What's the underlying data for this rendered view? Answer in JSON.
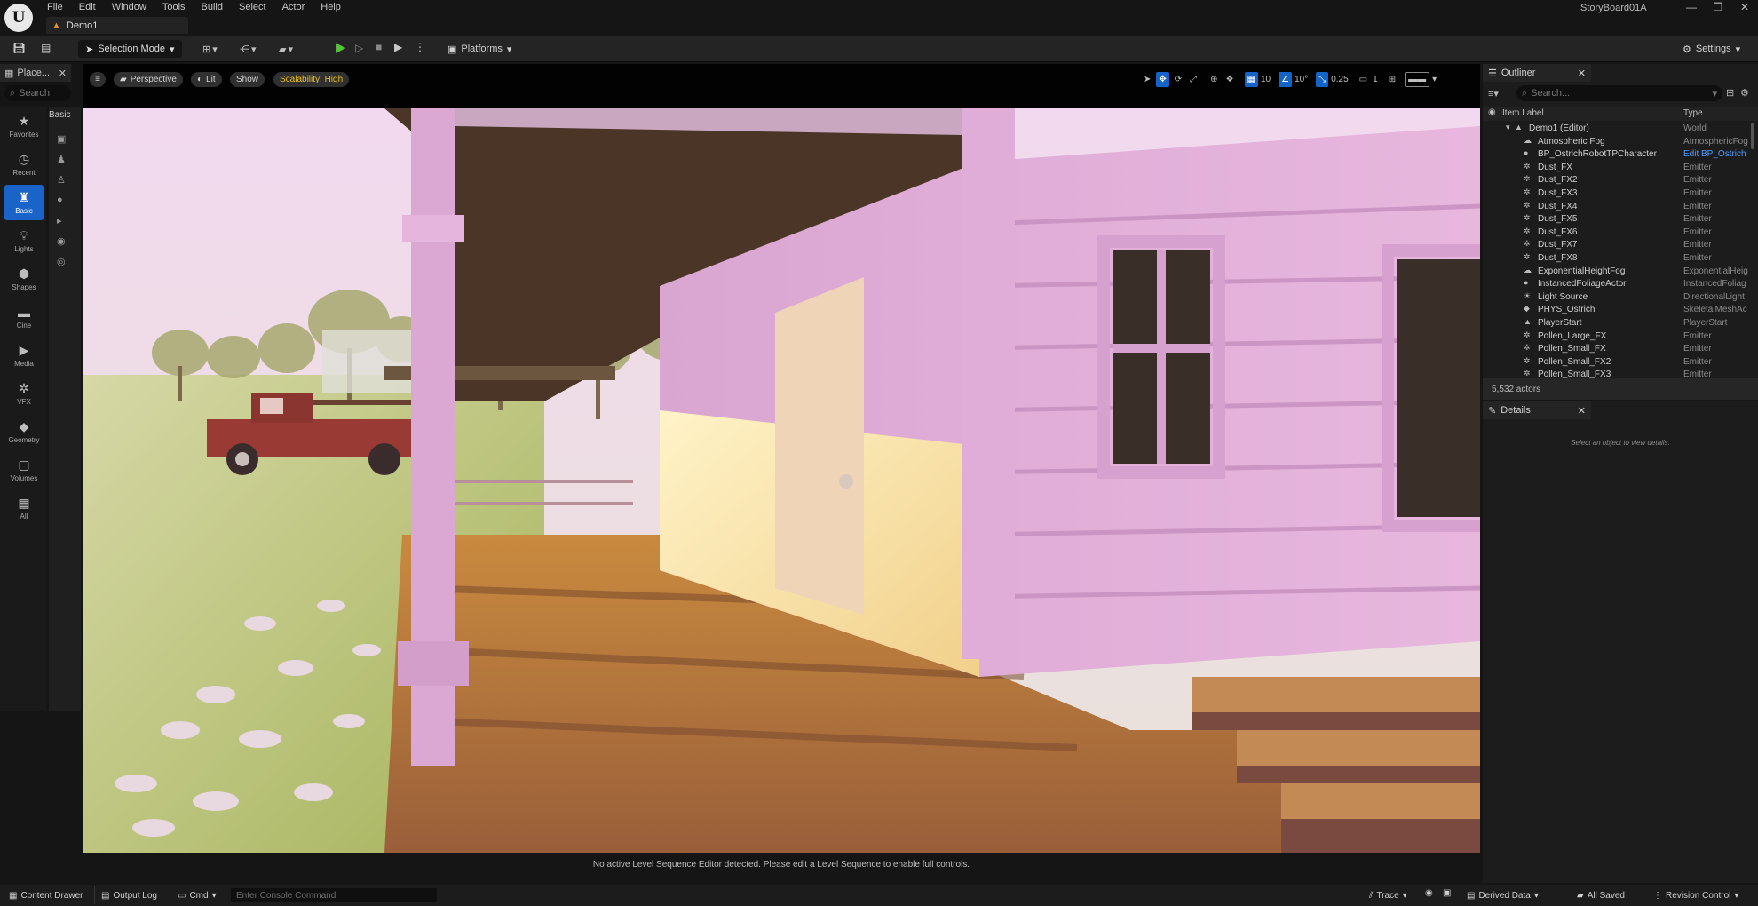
{
  "app": {
    "logo": "U",
    "project_name": "StoryBoard01A",
    "level_tab": "Demo1"
  },
  "menu": [
    "File",
    "Edit",
    "Window",
    "Tools",
    "Build",
    "Select",
    "Actor",
    "Help"
  ],
  "window_controls": [
    "—",
    "❐",
    "✕"
  ],
  "toolbar": {
    "selection_mode": "Selection Mode",
    "platforms": "Platforms",
    "settings": "Settings"
  },
  "place_panel": {
    "title": "Place...",
    "search_placeholder": "Search",
    "categories": [
      "Favorites",
      "Recent",
      "Basic",
      "Lights",
      "Shapes",
      "Cine",
      "Media",
      "VFX",
      "Geometry",
      "Volumes",
      "All"
    ],
    "active_category": "Basic",
    "basic_header": "Basic"
  },
  "viewport": {
    "perspective": "Perspective",
    "lit": "Lit",
    "show": "Show",
    "scalability": "Scalability: High",
    "grid_snap": "10",
    "rot_snap": "10°",
    "scale_snap": "0.25",
    "camera_speed": "1",
    "sequencer_message": "No active Level Sequence Editor detected. Please edit a Level Sequence to enable full controls."
  },
  "outliner": {
    "title": "Outliner",
    "search_placeholder": "Search...",
    "col_label": "Item Label",
    "col_type": "Type",
    "root": {
      "label": "Demo1 (Editor)",
      "type": "World"
    },
    "rows": [
      {
        "label": "Atmospheric Fog",
        "type": "AtmosphericFog",
        "icon": "☁"
      },
      {
        "label": "BP_OstrichRobotTPCharacter",
        "type": "Edit BP_Ostrich",
        "icon": "●",
        "link": true
      },
      {
        "label": "Dust_FX",
        "type": "Emitter",
        "icon": "✲"
      },
      {
        "label": "Dust_FX2",
        "type": "Emitter",
        "icon": "✲"
      },
      {
        "label": "Dust_FX3",
        "type": "Emitter",
        "icon": "✲"
      },
      {
        "label": "Dust_FX4",
        "type": "Emitter",
        "icon": "✲"
      },
      {
        "label": "Dust_FX5",
        "type": "Emitter",
        "icon": "✲"
      },
      {
        "label": "Dust_FX6",
        "type": "Emitter",
        "icon": "✲"
      },
      {
        "label": "Dust_FX7",
        "type": "Emitter",
        "icon": "✲"
      },
      {
        "label": "Dust_FX8",
        "type": "Emitter",
        "icon": "✲"
      },
      {
        "label": "ExponentialHeightFog",
        "type": "ExponentialHeig",
        "icon": "☁"
      },
      {
        "label": "InstancedFoliageActor",
        "type": "InstancedFoliag",
        "icon": "●"
      },
      {
        "label": "Light Source",
        "type": "DirectionalLight",
        "icon": "☀"
      },
      {
        "label": "PHYS_Ostrich",
        "type": "SkeletalMeshAc",
        "icon": "◆"
      },
      {
        "label": "PlayerStart",
        "type": "PlayerStart",
        "icon": "▲"
      },
      {
        "label": "Pollen_Large_FX",
        "type": "Emitter",
        "icon": "✲"
      },
      {
        "label": "Pollen_Small_FX",
        "type": "Emitter",
        "icon": "✲"
      },
      {
        "label": "Pollen_Small_FX2",
        "type": "Emitter",
        "icon": "✲"
      },
      {
        "label": "Pollen_Small_FX3",
        "type": "Emitter",
        "icon": "✲"
      }
    ],
    "footer": "5,532 actors"
  },
  "details": {
    "title": "Details",
    "empty_message": "Select an object to view details."
  },
  "bottom": {
    "content_drawer": "Content Drawer",
    "output_log": "Output Log",
    "cmd": "Cmd",
    "console_placeholder": "Enter Console Command",
    "trace": "Trace",
    "derived_data": "Derived Data",
    "all_saved": "All Saved",
    "revision_control": "Revision Control"
  },
  "colors": {
    "accent": "#1463c8",
    "play": "#55c23b",
    "scalability": "#e8c020",
    "link": "#4f9cff"
  }
}
